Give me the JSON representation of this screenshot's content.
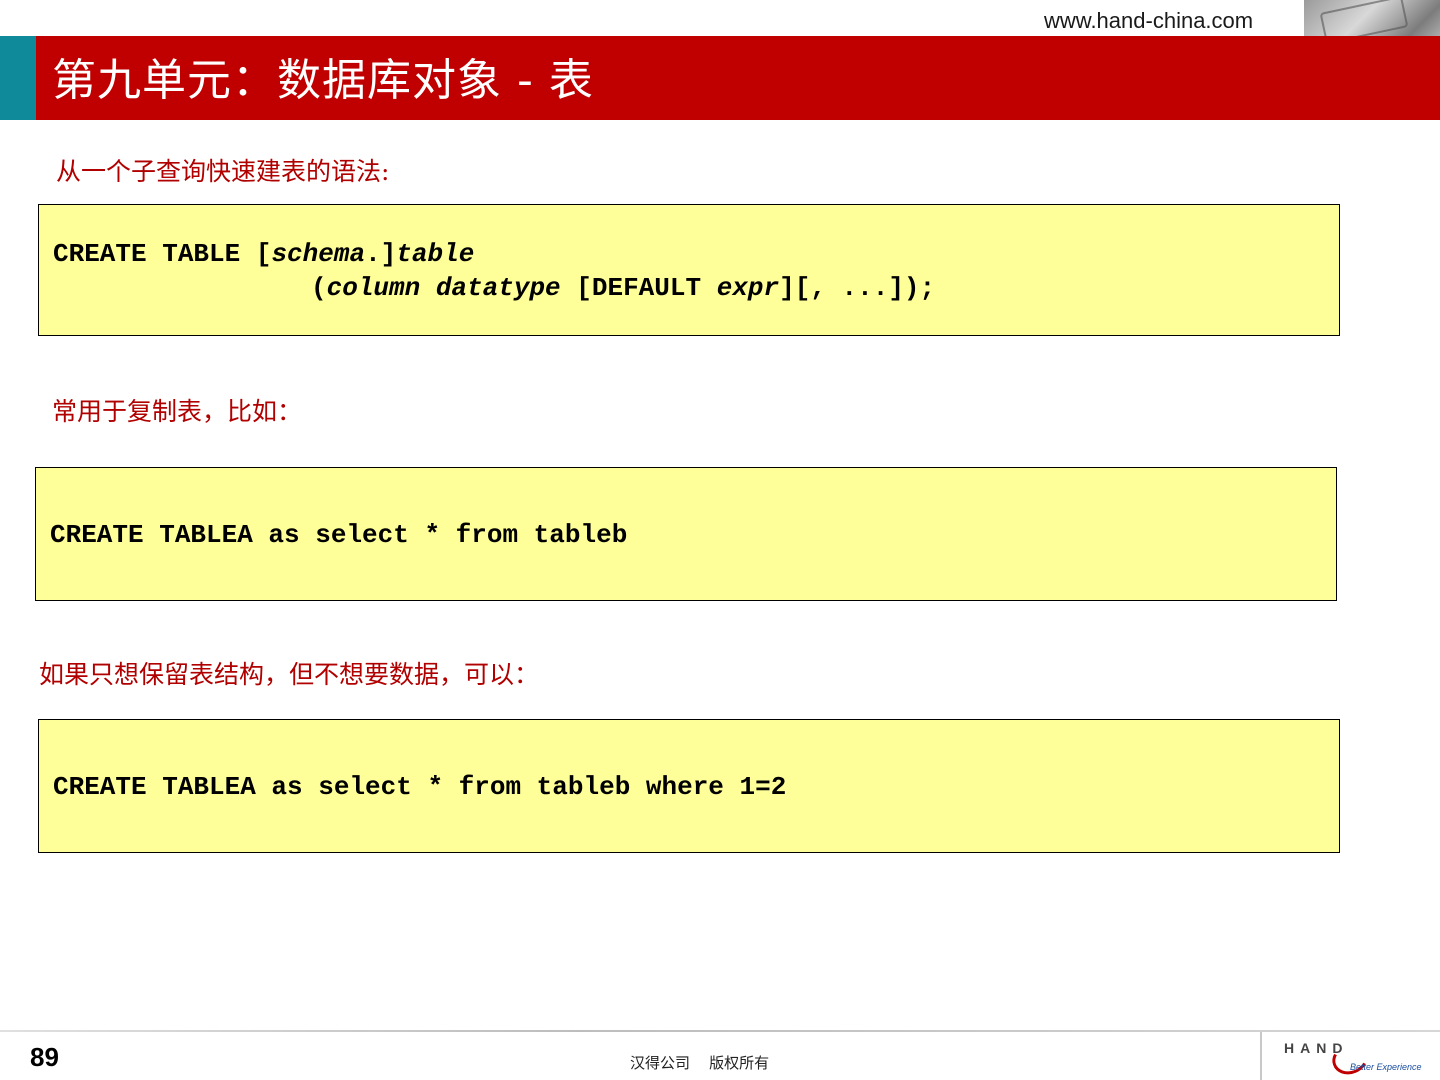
{
  "header": {
    "url": "www.hand-china.com",
    "title": "第九单元：数据库对象 - 表"
  },
  "sections": [
    {
      "caption": "从一个子查询快速建表的语法:",
      "code": {
        "line1": {
          "kw1": "CREATE TABLE [",
          "it1": "schema",
          "kw2": ".]",
          "it2": "table"
        },
        "line2": {
          "kw1": "(",
          "it1": "column datatype",
          "kw2": " [DEFAULT ",
          "it2": "expr",
          "kw3": "][, ...]);"
        }
      }
    },
    {
      "caption": "常用于复制表，比如：",
      "code_line": "CREATE TABLEA as select * from tableb"
    },
    {
      "caption": "如果只想保留表结构，但不想要数据，可以：",
      "code_line": "CREATE TABLEA as select * from tableb where 1=2"
    }
  ],
  "footer": {
    "page_number": "89",
    "copyright": "汉得公司    版权所有",
    "logo_text": "HAND",
    "logo_tagline": "Better Experience"
  }
}
